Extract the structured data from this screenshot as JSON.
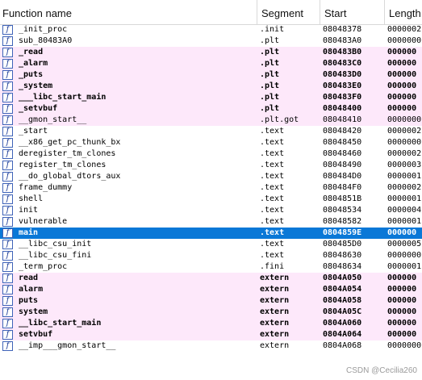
{
  "columns": {
    "function_name": "Function name",
    "segment": "Segment",
    "start": "Start",
    "length": "Length"
  },
  "icon_glyph": "f",
  "icon_name": "function-icon",
  "selection_color": "#0a78d7",
  "highlight_color": "#fde8fa",
  "rows": [
    {
      "name": "_init_proc",
      "segment": ".init",
      "start": "08048378",
      "length": "0000002",
      "style": "normal"
    },
    {
      "name": "sub_80483A0",
      "segment": ".plt",
      "start": "080483A0",
      "length": "0000000",
      "style": "normal"
    },
    {
      "name": "_read",
      "segment": ".plt",
      "start": "080483B0",
      "length": "000000",
      "style": "plt-bold"
    },
    {
      "name": "_alarm",
      "segment": ".plt",
      "start": "080483C0",
      "length": "000000",
      "style": "plt-bold"
    },
    {
      "name": "_puts",
      "segment": ".plt",
      "start": "080483D0",
      "length": "000000",
      "style": "plt-bold"
    },
    {
      "name": "_system",
      "segment": ".plt",
      "start": "080483E0",
      "length": "000000",
      "style": "plt-bold"
    },
    {
      "name": "___libc_start_main",
      "segment": ".plt",
      "start": "080483F0",
      "length": "000000",
      "style": "plt-bold"
    },
    {
      "name": "_setvbuf",
      "segment": ".plt",
      "start": "08048400",
      "length": "000000",
      "style": "plt-bold"
    },
    {
      "name": "__gmon_start__",
      "segment": ".plt.got",
      "start": "08048410",
      "length": "0000000",
      "style": "plt"
    },
    {
      "name": "_start",
      "segment": ".text",
      "start": "08048420",
      "length": "0000002",
      "style": "normal"
    },
    {
      "name": "__x86_get_pc_thunk_bx",
      "segment": ".text",
      "start": "08048450",
      "length": "0000000",
      "style": "normal"
    },
    {
      "name": "deregister_tm_clones",
      "segment": ".text",
      "start": "08048460",
      "length": "0000002",
      "style": "normal"
    },
    {
      "name": "register_tm_clones",
      "segment": ".text",
      "start": "08048490",
      "length": "0000003",
      "style": "normal"
    },
    {
      "name": "__do_global_dtors_aux",
      "segment": ".text",
      "start": "080484D0",
      "length": "0000001",
      "style": "normal"
    },
    {
      "name": "frame_dummy",
      "segment": ".text",
      "start": "080484F0",
      "length": "0000002",
      "style": "normal"
    },
    {
      "name": "shell",
      "segment": ".text",
      "start": "0804851B",
      "length": "0000001",
      "style": "normal"
    },
    {
      "name": "init",
      "segment": ".text",
      "start": "08048534",
      "length": "0000004",
      "style": "normal"
    },
    {
      "name": "vulnerable",
      "segment": ".text",
      "start": "08048582",
      "length": "0000001",
      "style": "normal"
    },
    {
      "name": "main",
      "segment": ".text",
      "start": "0804859E",
      "length": "000000",
      "style": "selected"
    },
    {
      "name": "__libc_csu_init",
      "segment": ".text",
      "start": "080485D0",
      "length": "0000005",
      "style": "normal"
    },
    {
      "name": "__libc_csu_fini",
      "segment": ".text",
      "start": "08048630",
      "length": "0000000",
      "style": "normal"
    },
    {
      "name": "_term_proc",
      "segment": ".fini",
      "start": "08048634",
      "length": "0000001",
      "style": "normal"
    },
    {
      "name": "read",
      "segment": "extern",
      "start": "0804A050",
      "length": "000000",
      "style": "ext-bold"
    },
    {
      "name": "alarm",
      "segment": "extern",
      "start": "0804A054",
      "length": "000000",
      "style": "ext-bold"
    },
    {
      "name": "puts",
      "segment": "extern",
      "start": "0804A058",
      "length": "000000",
      "style": "ext-bold"
    },
    {
      "name": "system",
      "segment": "extern",
      "start": "0804A05C",
      "length": "000000",
      "style": "ext-bold"
    },
    {
      "name": "__libc_start_main",
      "segment": "extern",
      "start": "0804A060",
      "length": "000000",
      "style": "ext-bold"
    },
    {
      "name": "setvbuf",
      "segment": "extern",
      "start": "0804A064",
      "length": "000000",
      "style": "ext-bold"
    },
    {
      "name": "__imp___gmon_start__",
      "segment": "extern",
      "start": "0804A068",
      "length": "0000000",
      "style": "normal"
    }
  ],
  "watermark": "CSDN @Cecilia260"
}
